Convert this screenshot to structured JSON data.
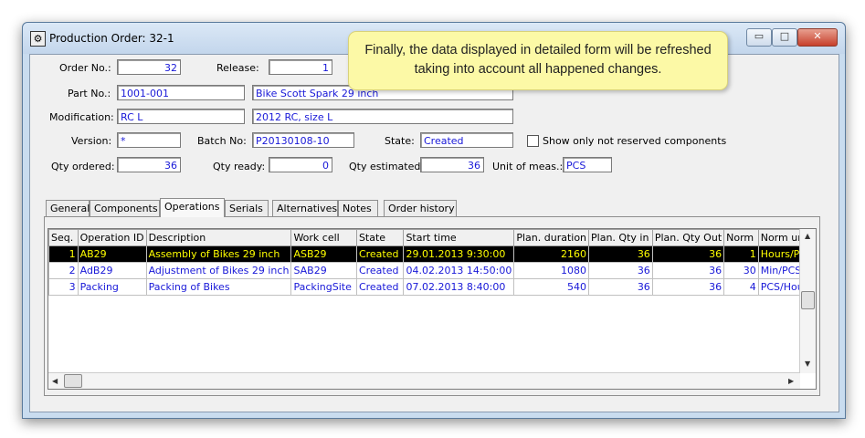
{
  "window": {
    "title": "Production Order: 32-1",
    "minimize_glyph": "▭",
    "maximize_glyph": "□",
    "close_glyph": "✕"
  },
  "tooltip": {
    "text": "Finally, the data displayed in detailed form will be refreshed taking into account all happened changes."
  },
  "form": {
    "order_no_label": "Order No.:",
    "order_no_value": "32",
    "release_label": "Release:",
    "release_value": "1",
    "part_no_label": "Part No.:",
    "part_no_value": "1001-001",
    "part_name_value": "Bike Scott Spark 29 inch",
    "modification_label": "Modification:",
    "modification_value": "RC L",
    "modification_desc_value": "2012 RC, size L",
    "version_label": "Version:",
    "version_value": "*",
    "batch_no_label": "Batch No:",
    "batch_no_value": "P20130108-10",
    "state_label": "State:",
    "state_value": "Created",
    "only_not_reserved_label": "Show only not reserved components",
    "qty_ordered_label": "Qty ordered:",
    "qty_ordered_value": "36",
    "qty_ready_label": "Qty ready:",
    "qty_ready_value": "0",
    "qty_estimated_label": "Qty estimated:",
    "qty_estimated_value": "36",
    "unit_label": "Unit of meas.:",
    "unit_value": "PCS"
  },
  "tabs": [
    "General",
    "Components",
    "Operations",
    "Serials",
    "Alternatives",
    "Notes",
    "Order history"
  ],
  "active_tab": "Operations",
  "grid": {
    "columns": [
      "Seq.",
      "Operation ID",
      "Description",
      "Work cell",
      "State",
      "Start time",
      "Plan. duration",
      "Plan. Qty in",
      "Plan. Qty Out",
      "Norm",
      "Norm unit"
    ],
    "rows": [
      [
        "1",
        "AB29",
        "Assembly of Bikes 29 inch",
        "ASB29",
        "Created",
        "29.01.2013 9:30:00",
        "2160",
        "36",
        "36",
        "1",
        "Hours/PCS"
      ],
      [
        "2",
        "AdB29",
        "Adjustment of Bikes 29 inch",
        "SAB29",
        "Created",
        "04.02.2013 14:50:00",
        "1080",
        "36",
        "36",
        "30",
        "Min/PCS"
      ],
      [
        "3",
        "Packing",
        "Packing of Bikes",
        "PackingSite",
        "Created",
        "07.02.2013 8:40:00",
        "540",
        "36",
        "36",
        "4",
        "PCS/Hour"
      ]
    ],
    "selected_row": 0
  },
  "scroll": {
    "up": "▲",
    "down": "▼",
    "left": "◀",
    "right": "▶"
  },
  "colors": {
    "field_text": "#1818d8",
    "selected_row_bg": "#000000",
    "selected_row_text": "#ffff00",
    "tooltip_bg": "#fcf9a6"
  }
}
